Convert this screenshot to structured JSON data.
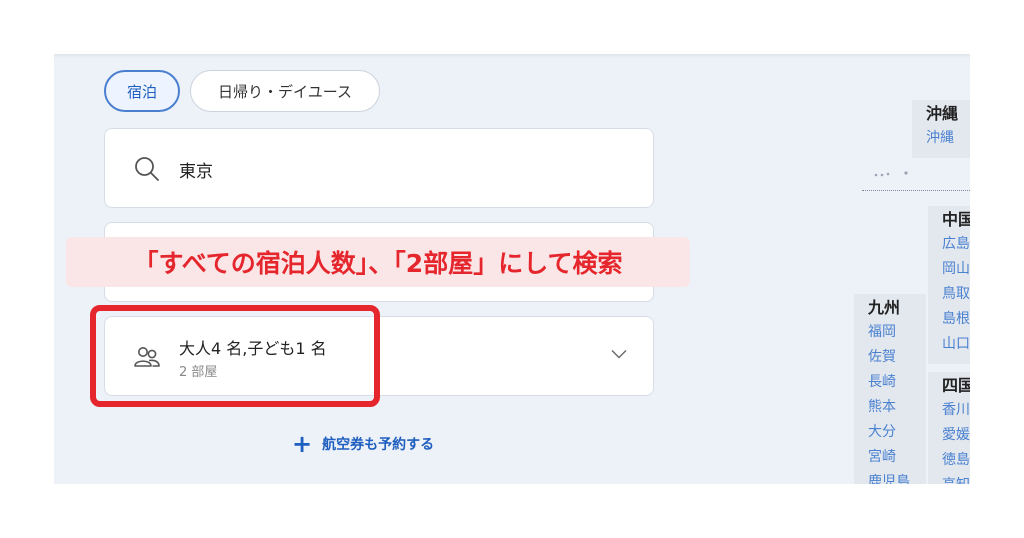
{
  "tabs": [
    {
      "label": "宿泊",
      "selected": true
    },
    {
      "label": "日帰り・デイユース",
      "selected": false
    }
  ],
  "search": {
    "value": "東京",
    "icon": "search-icon"
  },
  "guests": {
    "summary": "大人4 名,子ども1 名",
    "rooms": "2 部屋",
    "icon": "guests-icon"
  },
  "flight_link": {
    "icon": "plus-icon",
    "label": "航空券も予約する"
  },
  "annotation": {
    "text": "「すべての宿泊人数」、「2部屋」にして検索",
    "color": "#e5272d"
  },
  "map_regions": {
    "okinawa": {
      "name": "沖縄",
      "prefs": [
        "沖縄"
      ]
    },
    "chugoku": {
      "name": "中国",
      "prefs": [
        "広島",
        "岡山",
        "鳥取",
        "島根",
        "山口"
      ]
    },
    "kyushu": {
      "name": "九州",
      "prefs": [
        "福岡",
        "佐賀",
        "長崎",
        "熊本",
        "大分",
        "宮崎",
        "鹿児島"
      ]
    },
    "shikoku": {
      "name": "四国",
      "prefs": [
        "香川",
        "愛媛",
        "徳島",
        "高知"
      ]
    }
  },
  "colors": {
    "accent": "#1f5fbf",
    "link": "#4a82d0",
    "panel_bg": "#edf1f8",
    "highlight": "#e5272d"
  }
}
